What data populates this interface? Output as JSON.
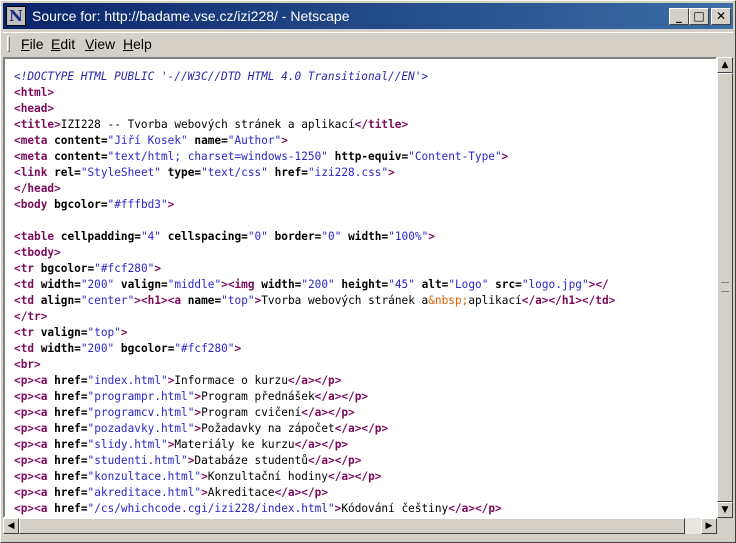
{
  "window": {
    "title": "Source for: http://badame.vse.cz/izi228/ - Netscape",
    "app_icon_letter": "N",
    "controls": {
      "minimize": "_",
      "maximize": "□",
      "close": "✕"
    }
  },
  "menu": [
    "File",
    "Edit",
    "View",
    "Help"
  ],
  "source_lines": [
    "<!DOCTYPE HTML PUBLIC '-//W3C//DTD HTML 4.0 Transitional//EN'>",
    "<html>",
    "<head>",
    "<title>IZI228 -- Tvorba webových stránek a aplikací</title>",
    "<meta content=\"Jiří Kosek\" name=\"Author\">",
    "<meta content=\"text/html; charset=windows-1250\" http-equiv=\"Content-Type\">",
    "<link rel=\"StyleSheet\" type=\"text/css\" href=\"izi228.css\">",
    "</head>",
    "<body bgcolor=\"#fffbd3\">",
    "",
    "<table cellpadding=\"4\" cellspacing=\"0\" border=\"0\" width=\"100%\">",
    "<tbody>",
    "<tr bgcolor=\"#fcf280\">",
    "<td width=\"200\" valign=\"middle\"><img width=\"200\" height=\"45\" alt=\"Logo\" src=\"logo.jpg\"></",
    "<td align=\"center\"><h1><a name=\"top\">Tvorba webových stránek a&nbsp;aplikací</a></h1></td>",
    "</tr>",
    "<tr valign=\"top\">",
    "<td width=\"200\" bgcolor=\"#fcf280\">",
    "<br>",
    "<p><a href=\"index.html\">Informace o kurzu</a></p>",
    "<p><a href=\"programpr.html\">Program přednášek</a></p>",
    "<p><a href=\"programcv.html\">Program cvičení</a></p>",
    "<p><a href=\"pozadavky.html\">Požadavky na zápočet</a></p>",
    "<p><a href=\"slidy.html\">Materiály ke kurzu</a></p>",
    "<p><a href=\"studenti.html\">Databáze studentů</a></p>",
    "<p><a href=\"konzultace.html\">Konzultační hodiny</a></p>",
    "<p><a href=\"akreditace.html\">Akreditace</a></p>",
    "<p><a href=\"/cs/whichcode.cgi/izi228/index.html\">Kódování češtiny</a></p>"
  ],
  "scrollbars": {
    "up": "▲",
    "down": "▼",
    "left": "◀",
    "right": "▶"
  },
  "colors": {
    "titlebar_start": "#0a246a",
    "titlebar_end": "#3a6ea5",
    "tag": "#7a0a5c",
    "value": "#2828c8",
    "comment": "#2a2aa6",
    "entity": "#e06000"
  }
}
